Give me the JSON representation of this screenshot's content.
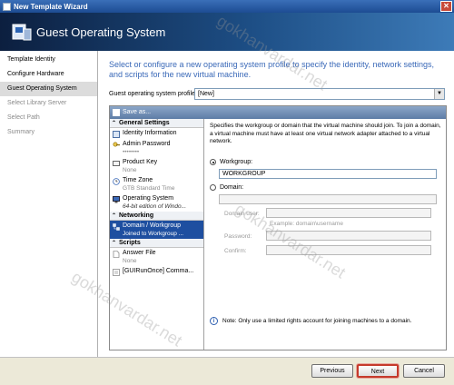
{
  "window": {
    "title": "New Template Wizard",
    "close_glyph": "✕"
  },
  "banner": {
    "title": "Guest Operating System"
  },
  "nav": {
    "items": [
      {
        "label": "Template Identity",
        "state": "normal"
      },
      {
        "label": "Configure Hardware",
        "state": "normal"
      },
      {
        "label": "Guest Operating System",
        "state": "active"
      },
      {
        "label": "Select Library Server",
        "state": "disabled"
      },
      {
        "label": "Select Path",
        "state": "disabled"
      },
      {
        "label": "Summary",
        "state": "disabled"
      }
    ]
  },
  "main": {
    "intro": "Select or configure a new operating system profile to specify the identity, network settings, and scripts for the new virtual machine.",
    "profile_label": "Guest operating system profile:",
    "profile_value": "[New]"
  },
  "panel": {
    "save_as": "Save as...",
    "sections": {
      "general": "General Settings",
      "networking": "Networking",
      "scripts": "Scripts"
    },
    "items": {
      "identity": {
        "name": "Identity Information",
        "sub": ""
      },
      "admin": {
        "name": "Admin Password",
        "sub": "••••••••"
      },
      "productkey": {
        "name": "Product Key",
        "sub": "None"
      },
      "timezone": {
        "name": "Time Zone",
        "sub": "GTB Standard Time"
      },
      "os": {
        "name": "Operating System",
        "sub": "64-bit edition of Windo..."
      },
      "domain": {
        "name": "Domain / Workgroup",
        "sub": "Joined to Workgroup ..."
      },
      "answerfile": {
        "name": "Answer File",
        "sub": "None"
      },
      "guirunonce": {
        "name": "[GUIRunOnce] Comma..."
      }
    },
    "detail": {
      "description": "Specifies the workgroup or domain that the virtual machine should join. To join a domain, a virtual machine must have at least one virtual network adapter attached to a virtual network.",
      "workgroup_label": "Workgroup:",
      "workgroup_value": "WORKGROUP",
      "domain_label": "Domain:",
      "domain_value": "",
      "domain_user_label": "Domain user:",
      "example": "Example: domain\\username",
      "password_label": "Password:",
      "confirm_label": "Confirm:",
      "note": "Note: Only use a limited rights account for joining machines to a domain."
    }
  },
  "footer": {
    "previous": "Previous",
    "next": "Next",
    "cancel": "Cancel"
  },
  "watermark": "gokhanvardar.net",
  "colors": {
    "accent": "#3a69b8",
    "selection": "#1e4fa0",
    "highlight": "#c53a2c"
  }
}
